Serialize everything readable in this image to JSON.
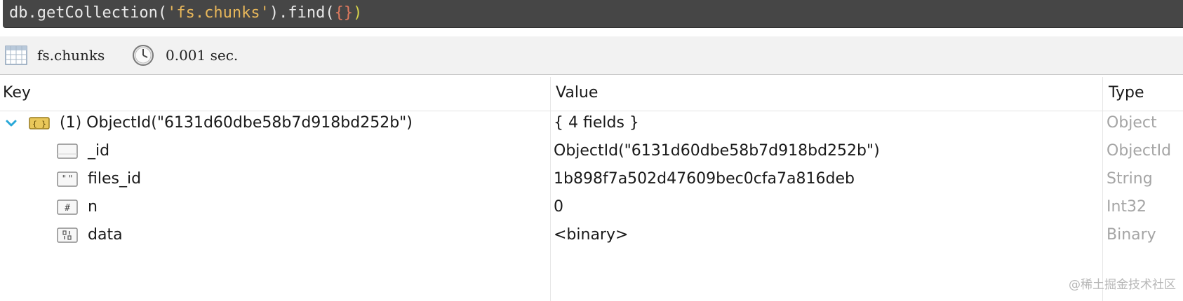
{
  "query": {
    "prefix": "db.getCollection(",
    "collection_arg": "'fs.chunks'",
    "mid": ").find(",
    "open_brace": "(",
    "object_literal": "{}",
    "close_paren": ")"
  },
  "info": {
    "collection": "fs.chunks",
    "time": "0.001 sec.",
    "icons": [
      "table-icon",
      "clock-icon"
    ]
  },
  "table": {
    "headers": {
      "key": "Key",
      "value": "Value",
      "type": "Type"
    },
    "document": {
      "key": "(1) ObjectId(\"6131d60dbe58b7d918bd252b\")",
      "value": "{ 4 fields }",
      "type": "Object",
      "icon": "document-icon"
    },
    "fields": [
      {
        "key": "_id",
        "value": "ObjectId(\"6131d60dbe58b7d918bd252b\")",
        "type": "ObjectId",
        "icon": "objectid-icon"
      },
      {
        "key": "files_id",
        "value": "1b898f7a502d47609bec0cfa7a816deb",
        "type": "String",
        "icon": "string-icon"
      },
      {
        "key": "n",
        "value": "0",
        "type": "Int32",
        "icon": "number-icon"
      },
      {
        "key": "data",
        "value": "<binary>",
        "type": "Binary",
        "icon": "binary-icon"
      }
    ]
  },
  "watermark": "@稀土掘金技术社区",
  "colors": {
    "query_bg": "#464646",
    "string_literal": "#e8b75a",
    "chevron": "#29a8d8",
    "type_text": "#a5a5a5"
  }
}
